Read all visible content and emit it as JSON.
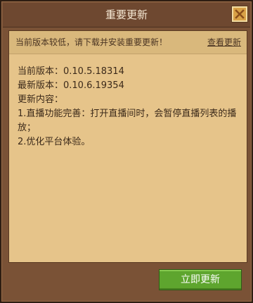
{
  "dialog": {
    "title": "重要更新",
    "close_icon": "close-icon"
  },
  "notice": {
    "text": "当前版本较低，请下载并安装重要更新！",
    "link": "查看更新"
  },
  "content": {
    "current_version": "当前版本：0.10.5.18314",
    "latest_version": "最新版本：0.10.6.19354",
    "update_heading": "更新内容：",
    "item1": "1.直播功能完善：打开直播间时，会暂停直播列表的播放；",
    "item2": "2.优化平台体验。"
  },
  "footer": {
    "update_button": "立即更新"
  },
  "colors": {
    "frame": "#7a5236",
    "panel": "#e6c48a",
    "accent_green": "#5ea52e",
    "close_gold": "#d8a146"
  }
}
